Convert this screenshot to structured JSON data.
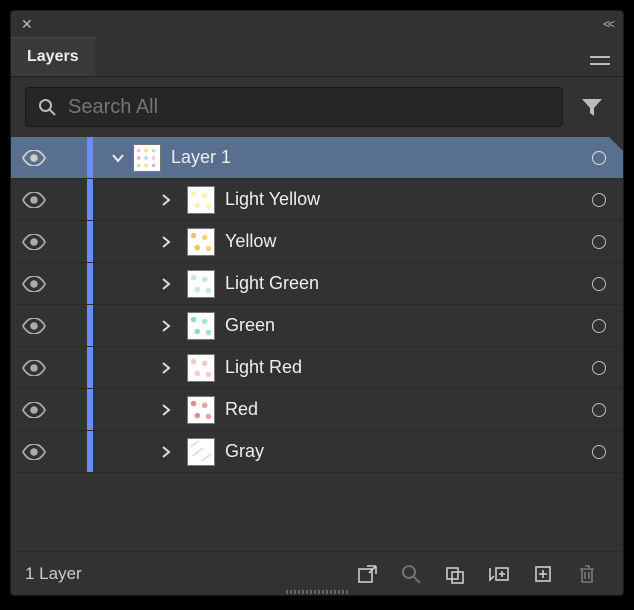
{
  "title": "Layers",
  "search": {
    "placeholder": "Search All"
  },
  "parent_layer": {
    "name": "Layer 1"
  },
  "sublayers": [
    {
      "name": "Light Yellow",
      "swatch": "lightyellow"
    },
    {
      "name": "Yellow",
      "swatch": "yellow"
    },
    {
      "name": "Light Green",
      "swatch": "lightgreen"
    },
    {
      "name": "Green",
      "swatch": "green"
    },
    {
      "name": "Light Red",
      "swatch": "lightred"
    },
    {
      "name": "Red",
      "swatch": "red"
    },
    {
      "name": "Gray",
      "swatch": "gray"
    }
  ],
  "footer": {
    "count_label": "1 Layer"
  }
}
